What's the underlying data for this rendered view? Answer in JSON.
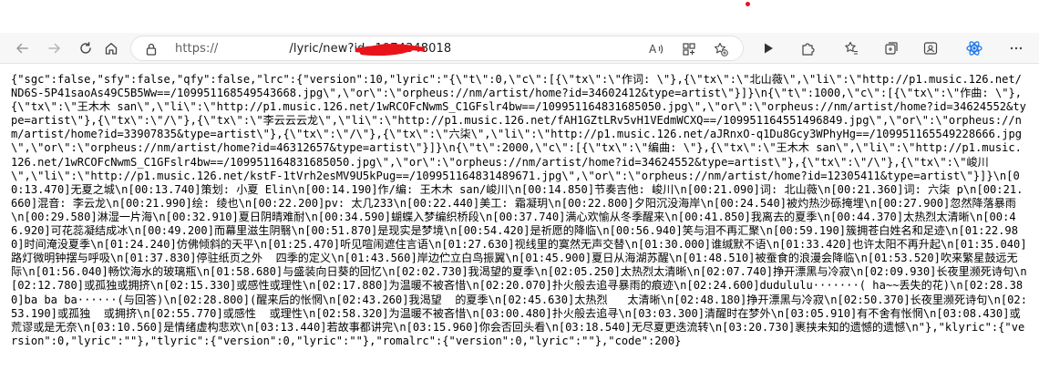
{
  "browser": {
    "address_bar": {
      "scheme_text": "https://",
      "path_text": "/lyric/new?id=1974348018"
    },
    "icons": {
      "left": [
        "back-arrow-icon",
        "forward-arrow-icon",
        "refresh-icon",
        "home-icon",
        "lock-icon"
      ],
      "address_right": [
        "read-aloud-icon",
        "grid-icon",
        "add-favorite-icon"
      ],
      "right": [
        "play-icon",
        "extensions-icon",
        "favorites-icon",
        "collections-icon",
        "profile-icon",
        "react-devtools-icon"
      ]
    },
    "accent_color": "#1a73e8",
    "redaction_color": "#e8141a"
  },
  "page": {
    "body_text": "{\"sgc\":false,\"sfy\":false,\"qfy\":false,\"lrc\":{\"version\":10,\"lyric\":\"{\\\"t\\\":0,\\\"c\\\":[{\\\"tx\\\":\\\"作词: \\\"},{\\\"tx\\\":\\\"北山薇\\\",\\\"li\\\":\\\"http://p1.music.126.net/ND6S-5P41saoAs49C5B5Ww==/109951168549543668.jpg\\\",\\\"or\\\":\\\"orpheus://nm/artist/home?id=34602412&type=artist\\\"}]}\\n{\\\"t\\\":1000,\\\"c\\\":[{\\\"tx\\\":\\\"作曲: \\\"},{\\\"tx\\\":\\\"王木木 san\\\",\\\"li\\\":\\\"http://p1.music.126.net/1wRCOFcNwmS_C1GFslr4bw==/109951164831685050.jpg\\\",\\\"or\\\":\\\"orpheus://nm/artist/home?id=34624552&type=artist\\\"},{\\\"tx\\\":\\\"/\\\"},{\\\"tx\\\":\\\"李云云云龙\\\",\\\"li\\\":\\\"http://p1.music.126.net/fAH1GZtLRv5vH1VEdmWCXQ==/109951164551496849.jpg\\\",\\\"or\\\":\\\"orpheus://nm/artist/home?id=33907835&type=artist\\\"},{\\\"tx\\\":\\\"/\\\"},{\\\"tx\\\":\\\"六柒\\\",\\\"li\\\":\\\"http://p1.music.126.net/aJRnxO-q1Du8Gcy3WPhyHg==/109951165549228666.jpg\\\",\\\"or\\\":\\\"orpheus://nm/artist/home?id=46312657&type=artist\\\"}]}\\n{\\\"t\\\":2000,\\\"c\\\":[{\\\"tx\\\":\\\"编曲: \\\"},{\\\"tx\\\":\\\"王木木 san\\\",\\\"li\\\":\\\"http://p1.music.126.net/1wRCOFcNwmS_C1GFslr4bw==/109951164831685050.jpg\\\",\\\"or\\\":\\\"orpheus://nm/artist/home?id=34624552&type=artist\\\"},{\\\"tx\\\":\\\"/\\\"},{\\\"tx\\\":\\\"峻川\\\",\\\"li\\\":\\\"http://p1.music.126.net/kstF-1tVrh2esMV9U5kPug==/109951164831489671.jpg\\\",\\\"or\\\":\\\"orpheus://nm/artist/home?id=12305411&type=artist\\\"}]}\\n[00:13.470]无夏之城\\n[00:13.740]策划: 小夏 Elin\\n[00:14.190]作/编: 王木木 san/峻川\\n[00:14.850]节奏吉他: 峻川\\n[00:21.090]词: 北山薇\\n[00:21.360]词: 六柒 p\\n[00:21.660]混音: 李云龙\\n[00:21.990]绘: 绫也\\n[00:22.200]pv: 太几233\\n[00:22.440]美工: 霜凝玥\\n[00:22.800]夕阳沉没海岸\\n[00:24.540]被灼热沙砾掩埋\\n[00:27.900]忽然降落暴雨\\n[00:29.580]淋湿一片海\\n[00:32.910]夏日阴晴难耐\\n[00:34.590]蝴蝶入梦编织桥段\\n[00:37.740]满心欢愉从冬季醒来\\n[00:41.850]我离去的夏季\\n[00:44.370]太热烈太清晰\\n[00:46.920]可花蕊凝结成冰\\n[00:49.200]而幕里滋生阴翳\\n[00:51.870]是现实是梦境\\n[00:54.420]是祈愿的降临\\n[00:56.940]笑与泪不再汇聚\\n[00:59.190]簇拥苍白姓名和足迹\\n[01:22.980]时间淹没夏季\\n[01:24.240]仿佛倾斜的天平\\n[01:25.470]听见喧闹遮住言语\\n[01:27.630]视线里的寞然无声交替\\n[01:30.000]谁缄默不语\\n[01:33.420]也许太阳不再升起\\n[01:35.040]路灯微明钟摆与呼吸\\n[01:37.830]停驻纸页之外  四季的定义\\n[01:43.560]岸边伫立白鸟振翼\\n[01:45.900]夏日从海湖苏醒\\n[01:48.510]被蚕食的浪漫会降临\\n[01:53.520]吹来繁星鼓远无际\\n[01:56.040]畅饮海水的玻璃瓶\\n[01:58.680]与盛装向日葵的回忆\\n[02:02.730]我渴望的夏季\\n[02:05.250]太热烈太清晰\\n[02:07.740]挣开漂黑与冷寂\\n[02:09.930]长夜里濒死诗句\\n[02:12.780]或孤独或拥挤\\n[02:15.330]或感性或理性\\n[02:17.880]为温暖不被吝惜\\n[02:20.070]扑火般去追寻暴雨的痕迹\\n[02:24.600]dudululu·······( ha~~丢失的花)\\n[02:28.380]ba ba ba······(与回答)\\n[02:28.800](醒来后的怅惘\\n[02:43.260]我渴望  的夏季\\n[02:45.630]太热烈   太清晰\\n[02:48.180]挣开漂黑与冷寂\\n[02:50.370]长夜里濒死诗句\\n[02:53.190]或孤独  或拥挤\\n[02:55.770]或感性  或理性\\n[02:58.320]为温暖不被吝惜\\n[03:00.480]扑火般去追寻\\n[03:03.300]清醒时在梦外\\n[03:05.910]有不舍有怅惘\\n[03:08.430]或荒谬或是无奈\\n[03:10.560]是情绪虚构悲欢\\n[03:13.440]若故事都讲完\\n[03:15.960]你会否回头看\\n[03:18.540]无尽夏更迭流转\\n[03:20.730]裹挟未知的遗憾的遗憾\\n\"},\"klyric\":{\"version\":0,\"lyric\":\"\"},\"tlyric\":{\"version\":0,\"lyric\":\"\"},\"romalrc\":{\"version\":0,\"lyric\":\"\"},\"code\":200}"
  }
}
